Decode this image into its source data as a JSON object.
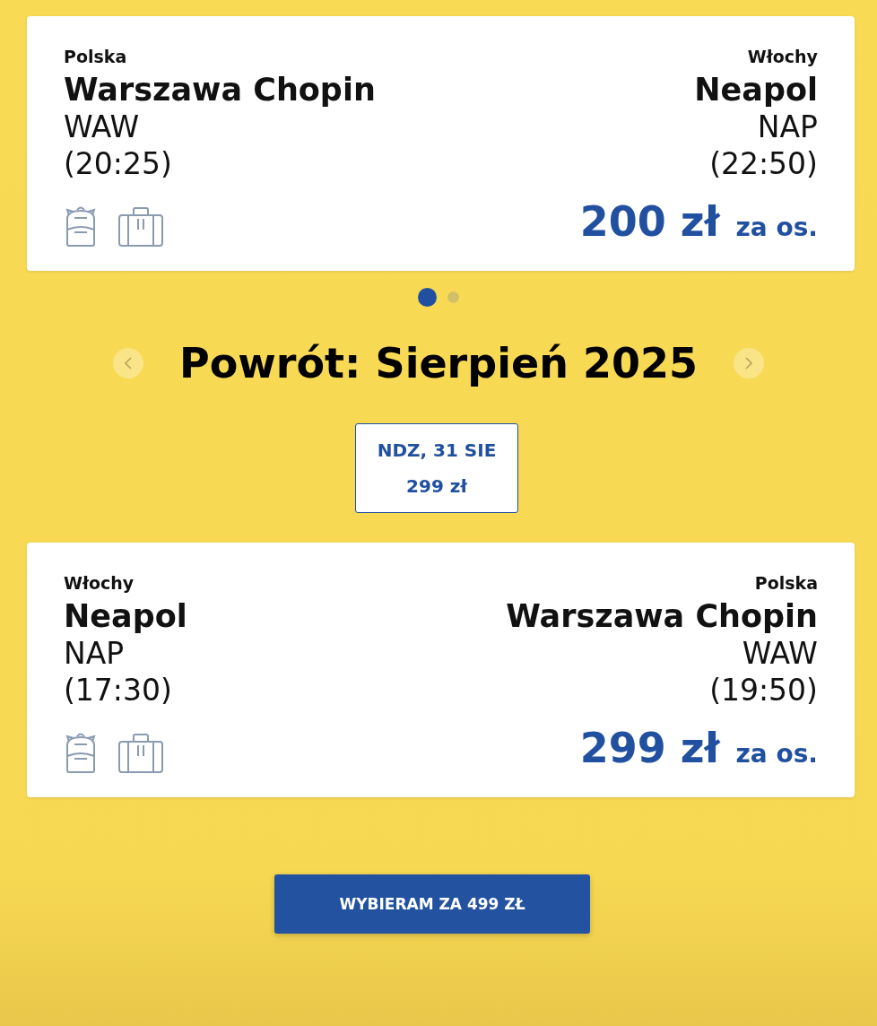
{
  "outbound": {
    "origin": {
      "country": "Polska",
      "city": "Warszawa Chopin",
      "code": "WAW",
      "time": "(20:25)"
    },
    "destination": {
      "country": "Włochy",
      "city": "Neapol",
      "code": "NAP",
      "time": "(22:50)"
    },
    "price": "200 zł",
    "price_unit": "za os."
  },
  "carousel_dots": [
    {
      "selected": true
    },
    {
      "selected": false
    }
  ],
  "return_heading": "Powrót: Sierpień 2025",
  "date_options": [
    {
      "day": "NDZ, 31 SIE",
      "price": "299 zł",
      "selected": true
    }
  ],
  "return": {
    "origin": {
      "country": "Włochy",
      "city": "Neapol",
      "code": "NAP",
      "time": "(17:30)"
    },
    "destination": {
      "country": "Polska",
      "city": "Warszawa Chopin",
      "code": "WAW",
      "time": "(19:50)"
    },
    "price": "299 zł",
    "price_unit": "za os."
  },
  "submit_button": "WYBIERAM ZA 499 ZŁ"
}
